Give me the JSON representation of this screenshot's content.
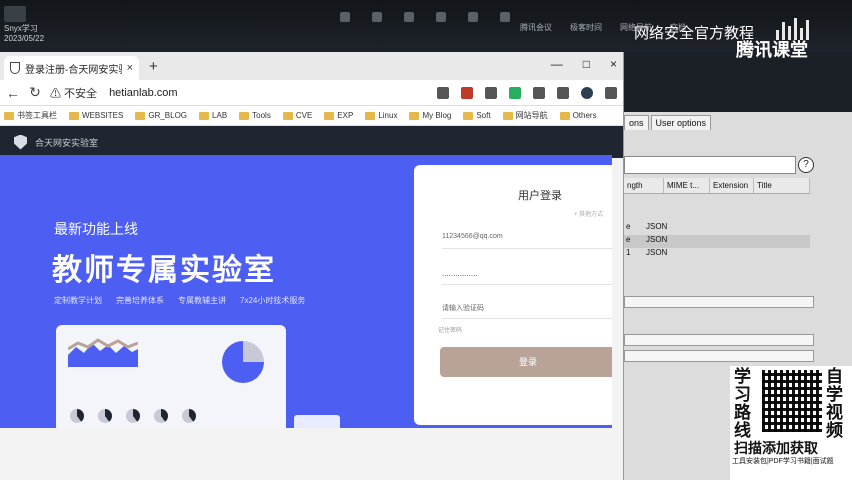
{
  "desktop": {
    "icon_label": "Snyx学习",
    "icon_sublabel": "2023/05/22",
    "top_labels": [
      "腾讯会议",
      "极客时间",
      "网络导航",
      "文档"
    ],
    "course_title": "网络安全官方教程",
    "course_brand": "腾讯课堂"
  },
  "browser": {
    "tab_title": "登录注册-合天网安实验室",
    "tab_close": "×",
    "new_tab": "+",
    "window_controls": [
      "—",
      "□",
      "×"
    ],
    "nav": {
      "back": "←",
      "reload": "↻"
    },
    "security_warning": "⚠ 不安全",
    "url": "hetianlab.com",
    "bookmarks": [
      "书签工具栏",
      "WEBSITES",
      "GR_BLOG",
      "LAB",
      "Tools",
      "CVE",
      "EXP",
      "Linux",
      "My Blog",
      "Soft",
      "网站导航",
      "Others"
    ]
  },
  "site": {
    "name": "合天网安实验室",
    "hero_subtitle": "最新功能上线",
    "hero_title": "教师专属实验室",
    "hero_features": [
      "定制教学计划",
      "完善培养体系",
      "专属教辅主讲",
      "7x24小时技术服务"
    ]
  },
  "login": {
    "title": "用户登录",
    "hint": "+ 其他方式",
    "email_value": "11234566@qq.com",
    "password_value": "................",
    "captcha_placeholder": "请输入验证码",
    "remember_label": "记住密码",
    "submit_label": "登录"
  },
  "burp": {
    "tabs": [
      "ons",
      "User options"
    ],
    "help": "?",
    "columns": [
      "ngth",
      "MIME t...",
      "Extension",
      "Title"
    ],
    "rows": [
      {
        "lead": "e",
        "mime": "JSON"
      },
      {
        "lead": "e",
        "mime": "JSON",
        "selected": true
      },
      {
        "lead": "1",
        "mime": "JSON"
      }
    ]
  },
  "promo": {
    "left_text": "学习路线",
    "right_text": "自学视频",
    "cta": "扫描添加获取",
    "small": "工具安装包|PDF学习书籍|面试题"
  }
}
